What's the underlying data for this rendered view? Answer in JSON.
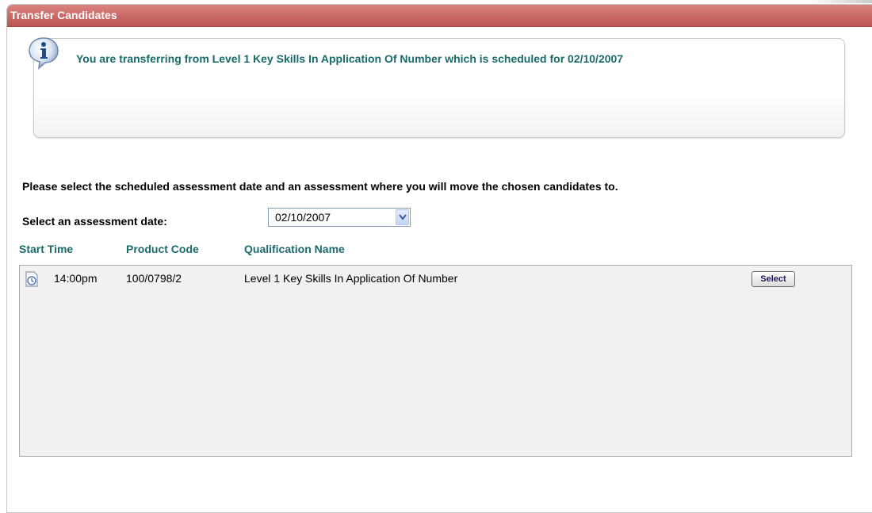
{
  "panel": {
    "title": "Transfer Candidates"
  },
  "info": {
    "icon": "info-icon",
    "message": "You are transferring from Level 1 Key Skills In Application Of Number which is scheduled for 02/10/2007"
  },
  "instruction": "Please select the scheduled assessment date and an assessment where you will move the chosen candidates to.",
  "date_picker": {
    "label": "Select an assessment date:",
    "selected": "02/10/2007",
    "icon": "chevron-down-icon"
  },
  "table": {
    "headers": [
      "Start Time",
      "Product Code",
      "Qualification Name"
    ],
    "rows": [
      {
        "icon": "clock-icon",
        "start_time": "14:00pm",
        "product_code": "100/0798/2",
        "qualification_name": "Level 1 Key Skills In Application Of Number",
        "action_label": "Select"
      }
    ]
  },
  "colors": {
    "header_red": "#c96966",
    "accent_teal": "#1a6b6b",
    "list_bg": "#f1f1f1"
  }
}
